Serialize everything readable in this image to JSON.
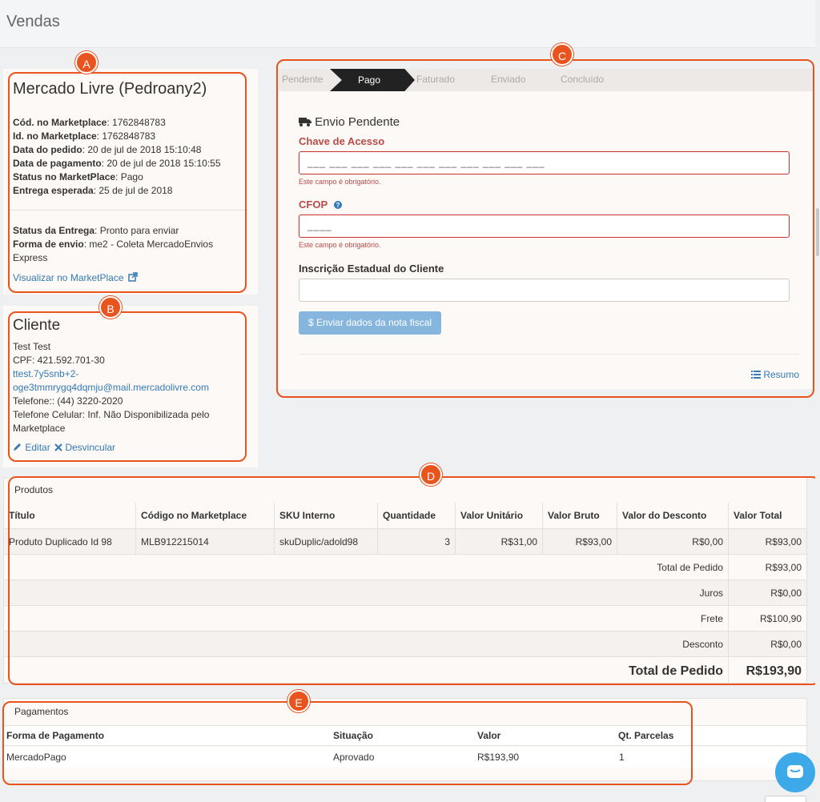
{
  "page_title": "Vendas",
  "markers": [
    "A",
    "B",
    "C",
    "D",
    "E"
  ],
  "marketplace": {
    "title": "Mercado Livre (Pedroany2)",
    "fields": [
      {
        "label": "Cód. no Marketplace",
        "value": ": 1762848783"
      },
      {
        "label": "Id. no Marketplace",
        "value": ": 1762848783"
      },
      {
        "label": "Data do pedido",
        "value": ": 20 de jul de 2018 15:10:48"
      },
      {
        "label": "Data de pagamento",
        "value": ": 20 de jul de 2018 15:10:55"
      },
      {
        "label": "Status no MarketPlace",
        "value": ": Pago"
      },
      {
        "label": "Entrega esperada",
        "value": ": 25 de jul de 2018"
      }
    ],
    "delivery_status_label": "Status da Entrega",
    "delivery_status_value": ": Pronto para enviar",
    "shipping_label": "Forma de envio",
    "shipping_value_1": ": me2 - Coleta MercadoEnvios",
    "shipping_value_2": "Express",
    "view_link": "Visualizar no MarketPlace",
    "view_icon": "external-link-icon"
  },
  "client": {
    "title": "Cliente",
    "name": "Test Test",
    "cpf": "CPF: 421.592.701-30",
    "email_1": "ttest.7y5snb+2-",
    "email_2": "oge3tmmrygq4dqmju@mail.mercadolivre.com",
    "phone": "Telefone:: (44) 3220-2020",
    "mobile_1": "Telefone Celular: Inf. Não Disponibilizada pelo",
    "mobile_2": "Marketplace",
    "edit_label": "Editar",
    "unlink_label": "Desvincular"
  },
  "status_panel": {
    "steps": [
      "Pendente",
      "Pago",
      "Faturado",
      "Enviado",
      "Concluído"
    ],
    "active_step": "Pago",
    "section_title": "Envio Pendente",
    "section_icon": "truck-icon",
    "access_key_label": "Chave de Acesso",
    "access_key_mask": "___ ___ ___ ___ ___ ___ ___ ___ ___ ___ ___",
    "access_key_error": "Este campo é obrigatório.",
    "cfop_label": "CFOP",
    "cfop_mask": "____",
    "cfop_error": "Este campo é obrigatório.",
    "ie_label": "Inscrição Estadual do Cliente",
    "ie_value": "",
    "submit_label": "$ Enviar dados da nota fiscal",
    "summary_label": "Resumo"
  },
  "products": {
    "title": "Produtos",
    "columns": [
      "Título",
      "Código no Marketplace",
      "SKU Interno",
      "Quantidade",
      "Valor Unitário",
      "Valor Bruto",
      "Valor do Desconto",
      "Valor Total"
    ],
    "rows": [
      [
        "Produto Duplicado Id 98",
        "MLB912215014",
        "skuDuplic/adold98",
        "3",
        "R$31,00",
        "R$93,00",
        "R$0,00",
        "R$93,00"
      ]
    ],
    "totals": [
      {
        "label": "Total de Pedido",
        "value": "R$93,00"
      },
      {
        "label": "Juros",
        "value": "R$0,00"
      },
      {
        "label": "Frete",
        "value": "R$100,90"
      },
      {
        "label": "Desconto",
        "value": "R$0,00"
      }
    ],
    "grand_total_label": "Total de Pedido",
    "grand_total_value": "R$193,90"
  },
  "payments": {
    "title": "Pagamentos",
    "columns": [
      "Forma de Pagamento",
      "Situação",
      "Valor",
      "Qt. Parcelas"
    ],
    "rows": [
      [
        "MercadoPago",
        "Aprovado",
        "R$193,90",
        "1"
      ]
    ]
  },
  "colors": {
    "annotation": "#e8531e",
    "link": "#337ab7",
    "error": "#b94a48",
    "chat": "#3da9e8"
  }
}
